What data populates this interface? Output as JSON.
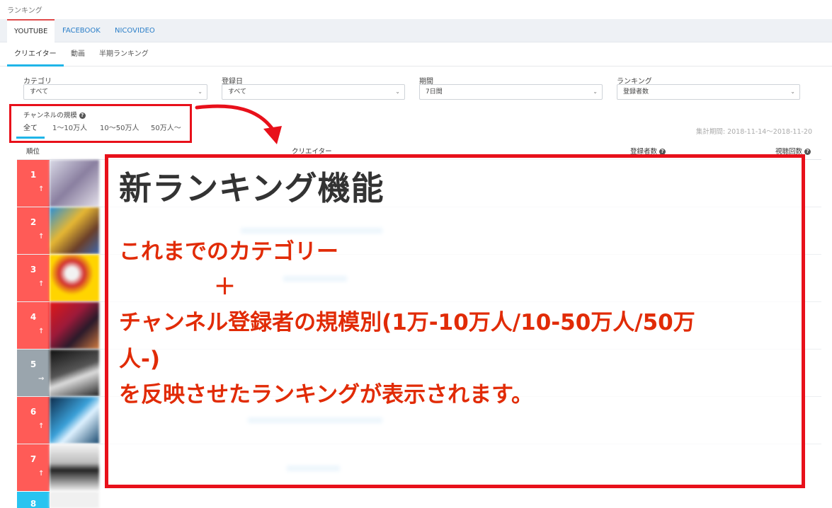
{
  "page_title": "ランキング",
  "top_tabs": [
    {
      "label": "YOUTUBE",
      "active": true
    },
    {
      "label": "FACEBOOK",
      "active": false
    },
    {
      "label": "NICOVIDEO",
      "active": false
    }
  ],
  "sub_tabs": [
    {
      "label": "クリエイター",
      "active": true
    },
    {
      "label": "動画",
      "active": false
    },
    {
      "label": "半期ランキング",
      "active": false
    }
  ],
  "filters": {
    "category": {
      "label": "カテゴリ",
      "value": "すべて"
    },
    "registered": {
      "label": "登録日",
      "value": "すべて"
    },
    "period": {
      "label": "期間",
      "value": "7日間"
    },
    "ranking": {
      "label": "ランキング",
      "value": "登録者数"
    }
  },
  "channel_scale": {
    "label": "チャンネルの規模",
    "tabs": [
      "全て",
      "1〜10万人",
      "10〜50万人",
      "50万人〜"
    ]
  },
  "period_text": "集計期間: 2018-11-14〜2018-11-20",
  "table": {
    "headers": {
      "rank": "順位",
      "creator": "クリエイター",
      "subscribers": "登録者数",
      "views": "視聴回数"
    },
    "rows": [
      {
        "rank": "1",
        "trend": "up",
        "color": "#ff5b57"
      },
      {
        "rank": "2",
        "trend": "up",
        "color": "#ff5b57"
      },
      {
        "rank": "3",
        "trend": "up",
        "color": "#ff5b57"
      },
      {
        "rank": "4",
        "trend": "up",
        "color": "#ff5b57"
      },
      {
        "rank": "5",
        "trend": "same",
        "color": "#9aa5ad"
      },
      {
        "rank": "6",
        "trend": "up",
        "color": "#ff5b57"
      },
      {
        "rank": "7",
        "trend": "up",
        "color": "#ff5b57"
      },
      {
        "rank": "8",
        "trend": "up",
        "color": "#28c4f0"
      }
    ]
  },
  "overlay": {
    "title": "新ランキング機能",
    "line1": "これまでのカテゴリー",
    "plus": "＋",
    "line2": "チャンネル登録者の規模別(1万-10万人/10-50万人/50万",
    "line3": "人-)",
    "line4": "を反映させたランキングが表示されます。"
  },
  "colors": {
    "accent_red": "#e8101a",
    "overlay_text": "#e12b06",
    "tab_underline": "#1fb5e8",
    "link": "#2a7ec8"
  }
}
